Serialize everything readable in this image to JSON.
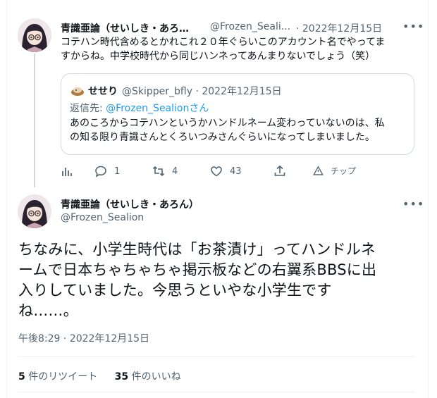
{
  "parent_tweet": {
    "name": "青識亜論（せいしき・あろ…",
    "handle": "@Frozen_Seali...",
    "date": "· 2022年12月15日",
    "text_line1": "コテハン時代含めるとかれこれ２０年ぐらいこのアカウント名でやってま",
    "text_line2": "すからね。中学校時代から同じハンネってあんまりないでしょう（笑）",
    "quote": {
      "name": "せせり",
      "handle": "@Skipper_bfly · 2022年12月15日",
      "reply_prefix": "返信先: ",
      "reply_to": "@Frozen_Sealionさん",
      "text_line1": "あのころからコテハンというかハンドルネーム変わっていないのは、私",
      "text_line2": "の知る限り青識さんとくろいつみさんぐらいになってしまいました。"
    },
    "actions": {
      "reply_count": "1",
      "retweet_count": "4",
      "like_count": "43",
      "tip_label": "チップ"
    }
  },
  "main_tweet": {
    "name": "青識亜論（せいしき・あろん）",
    "handle": "@Frozen_Sealion",
    "text_line1": "ちなみに、小学生時代は「お茶漬け」ってハンドルネ",
    "text_line2": "ームで日本ちゃちゃちゃ掲示板などの右翼系BBSに出",
    "text_line3": "入りしていました。今思うといやな小学生です",
    "text_line4": "ね……。",
    "time": "午後8:29 · 2022年12月15日",
    "retweets_count": "5",
    "retweets_label": "件のリツイート",
    "likes_count": "35",
    "likes_label": "件のいいね"
  },
  "colors": {
    "accent": "#1d9bf0",
    "text": "#0f1419",
    "muted": "#536471",
    "border": "#cfd9de"
  },
  "icons": [
    "more-icon",
    "analytics-icon",
    "reply-icon",
    "retweet-icon",
    "like-icon",
    "share-icon",
    "tip-icon"
  ]
}
